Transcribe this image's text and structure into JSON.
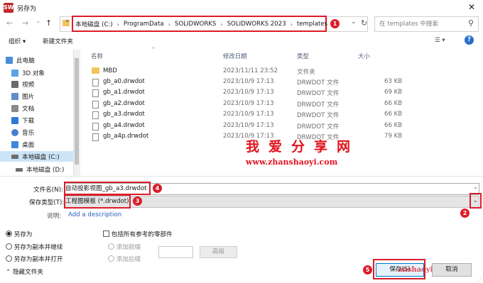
{
  "window": {
    "title": "另存为",
    "close": "✕"
  },
  "nav": {
    "back": "←",
    "forward": "→",
    "dropdown": "⌄",
    "up": "↑",
    "folder_glyph": "«"
  },
  "breadcrumb": [
    "本地磁盘 (C:)",
    "ProgramData",
    "SOLIDWORKS",
    "SOLIDWORKS 2023",
    "templates"
  ],
  "breadcrumb_sep": "›",
  "search": {
    "placeholder": "在 templates 中搜索",
    "icon_glyph": "⚲",
    "refresh": "↻"
  },
  "toolbar": {
    "organize": "组织 ▾",
    "new_folder": "新建文件夹",
    "view": "☰ ▾",
    "help": "?"
  },
  "sidebar": [
    {
      "label": "此电脑",
      "icon": "pc-icon",
      "color": "#4a8fd8"
    },
    {
      "label": "3D 对象",
      "icon": "3d-objects-icon",
      "color": "#5aa3e6"
    },
    {
      "label": "视频",
      "icon": "video-icon",
      "color": "#6b6b6b"
    },
    {
      "label": "图片",
      "icon": "picture-icon",
      "color": "#5a8fc8"
    },
    {
      "label": "文档",
      "icon": "document-icon",
      "color": "#8a8a8a"
    },
    {
      "label": "下载",
      "icon": "download-icon",
      "color": "#2f7ad6"
    },
    {
      "label": "音乐",
      "icon": "music-icon",
      "color": "#4a7fd0"
    },
    {
      "label": "桌面",
      "icon": "desktop-icon",
      "color": "#3f87d8"
    },
    {
      "label": "本地磁盘 (C:)",
      "icon": "drive-icon",
      "color": "#6d6d6d"
    },
    {
      "label": "本地磁盘 (D:)",
      "icon": "drive-icon",
      "color": "#6d6d6d"
    }
  ],
  "columns": {
    "name": "名称",
    "date": "修改日期",
    "type": "类型",
    "size": "大小"
  },
  "files": [
    {
      "name": "MBD",
      "date": "2023/11/11 23:52",
      "type": "文件夹",
      "size": "",
      "folder": true
    },
    {
      "name": "gb_a0.drwdot",
      "date": "2023/10/9 17:13",
      "type": "DRWDOT 文件",
      "size": "63 KB",
      "folder": false
    },
    {
      "name": "gb_a1.drwdot",
      "date": "2023/10/9 17:13",
      "type": "DRWDOT 文件",
      "size": "69 KB",
      "folder": false
    },
    {
      "name": "gb_a2.drwdot",
      "date": "2023/10/9 17:13",
      "type": "DRWDOT 文件",
      "size": "66 KB",
      "folder": false
    },
    {
      "name": "gb_a3.drwdot",
      "date": "2023/10/9 17:13",
      "type": "DRWDOT 文件",
      "size": "66 KB",
      "folder": false
    },
    {
      "name": "gb_a4.drwdot",
      "date": "2023/10/9 17:13",
      "type": "DRWDOT 文件",
      "size": "66 KB",
      "folder": false
    },
    {
      "name": "gb_a4p.drwdot",
      "date": "2023/10/9 17:13",
      "type": "DRWDOT 文件",
      "size": "79 KB",
      "folder": false
    }
  ],
  "watermark": {
    "title": "我爱分享网",
    "url": "www.zhanshaoyi.com",
    "button_overlay": "anshaoyi.com"
  },
  "form": {
    "filename_label": "文件名(N):",
    "filename_value": "自动投影视图_gb_a3.drwdot",
    "filetype_label": "保存类型(T):",
    "filetype_value": "工程图模板 (*.drwdot)",
    "desc_label": "说明:",
    "desc_link": "Add a description"
  },
  "options": {
    "save_as": "另存为",
    "save_as_copy_continue": "另存为副本并继续",
    "save_as_copy_open": "另存为副本并打开",
    "include_refs": "包括所有参考的零部件",
    "add_prefix": "添加前缀",
    "add_suffix": "添加后缀",
    "advanced": "高级",
    "hide_folders": "隐藏文件夹"
  },
  "buttons": {
    "save": "保存(S)",
    "cancel": "取消"
  },
  "badges": [
    "1",
    "2",
    "3",
    "4",
    "5"
  ],
  "accent": "#d91e2a"
}
